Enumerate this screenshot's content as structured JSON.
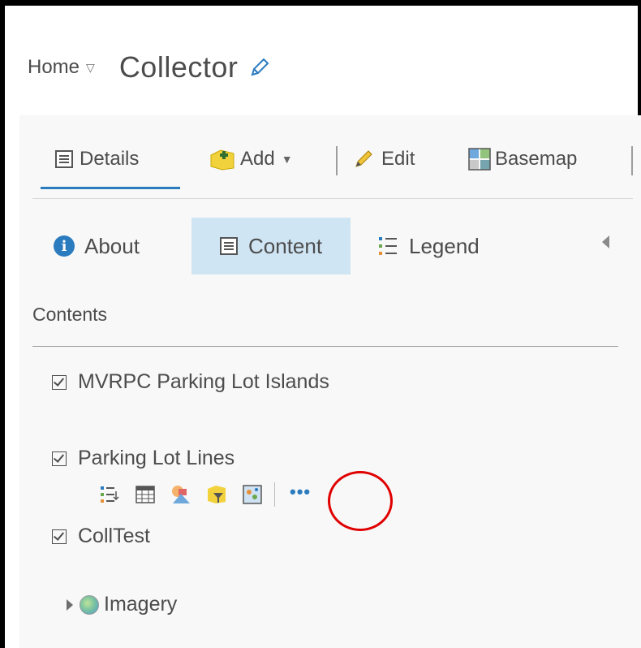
{
  "header": {
    "home_label": "Home",
    "title": "Collector"
  },
  "toolbar": {
    "details_label": "Details",
    "add_label": "Add",
    "edit_label": "Edit",
    "basemap_label": "Basemap"
  },
  "tabs": {
    "about_label": "About",
    "content_label": "Content",
    "legend_label": "Legend",
    "active": "Content"
  },
  "contents": {
    "title": "Contents",
    "layers": [
      {
        "name": "MVRPC Parking Lot Islands",
        "checked": true
      },
      {
        "name": "Parking Lot Lines",
        "checked": true
      },
      {
        "name": "CollTest",
        "checked": true
      }
    ],
    "more_label": "•••",
    "group_layer": "Imagery"
  },
  "colors": {
    "accent": "#2b7bbf",
    "active_tab_bg": "#cfe5f4",
    "highlight_circle": "#e00000"
  }
}
